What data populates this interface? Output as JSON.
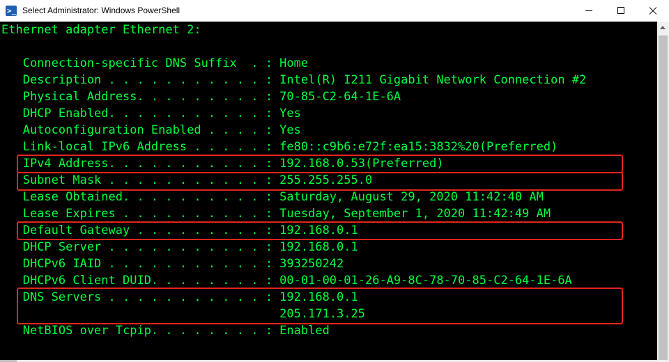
{
  "window": {
    "title": "Select Administrator: Windows PowerShell",
    "icon": "powershell-icon",
    "icon_glyph": ">_",
    "controls": [
      "minimize-icon",
      "maximize-icon",
      "close-icon"
    ]
  },
  "colors": {
    "console_background": "#000000",
    "console_text": "#00ff3c",
    "highlight_border": "#e2251e",
    "titlebar": "#ffffff"
  },
  "console": {
    "lines": [
      "Ethernet adapter Ethernet 2:",
      "",
      "   Connection-specific DNS Suffix  . : Home",
      "   Description . . . . . . . . . . . : Intel(R) I211 Gigabit Network Connection #2",
      "   Physical Address. . . . . . . . . : 70-85-C2-64-1E-6A",
      "   DHCP Enabled. . . . . . . . . . . : Yes",
      "   Autoconfiguration Enabled . . . . : Yes",
      "   Link-local IPv6 Address . . . . . : fe80::c9b6:e72f:ea15:3832%20(Preferred)",
      "   IPv4 Address. . . . . . . . . . . : 192.168.0.53(Preferred)",
      "   Subnet Mask . . . . . . . . . . . : 255.255.255.0",
      "   Lease Obtained. . . . . . . . . . : Saturday, August 29, 2020 11:42:40 AM",
      "   Lease Expires . . . . . . . . . . : Tuesday, September 1, 2020 11:42:49 AM",
      "   Default Gateway . . . . . . . . . : 192.168.0.1",
      "   DHCP Server . . . . . . . . . . . : 192.168.0.1",
      "   DHCPv6 IAID . . . . . . . . . . . : 393250242",
      "   DHCPv6 Client DUID. . . . . . . . : 00-01-00-01-26-A9-8C-78-70-85-C2-64-1E-6A",
      "   DNS Servers . . . . . . . . . . . : 192.168.0.1",
      "                                       205.171.3.25",
      "   NetBIOS over Tcpip. . . . . . . . : Enabled"
    ]
  }
}
